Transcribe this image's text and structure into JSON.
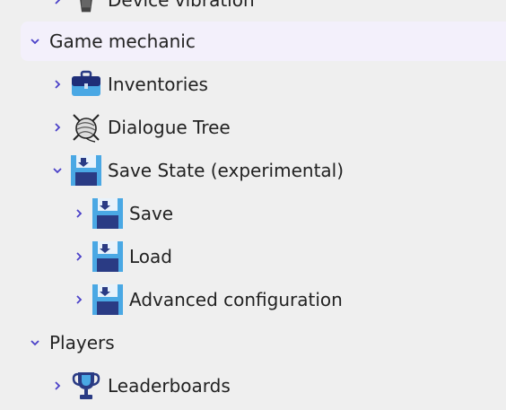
{
  "tree": {
    "device_vibration": "Device vibration",
    "game_mechanic": "Game mechanic",
    "inventories": "Inventories",
    "dialogue_tree": "Dialogue Tree",
    "save_state": "Save State (experimental)",
    "save": "Save",
    "load": "Load",
    "advanced_configuration": "Advanced configuration",
    "players": "Players",
    "leaderboards": "Leaderboards"
  },
  "colors": {
    "chevron": "#4a40c8",
    "highlight": "#f3f0fb",
    "background": "#efefef"
  },
  "icons": {
    "device_vibration": "phone-vibration-icon",
    "inventories": "briefcase-icon",
    "dialogue_tree": "yarn-ball-icon",
    "save_state": "floppy-disk-icon",
    "save": "floppy-disk-icon",
    "load": "floppy-disk-icon",
    "advanced_configuration": "floppy-disk-icon",
    "leaderboards": "trophy-icon"
  }
}
